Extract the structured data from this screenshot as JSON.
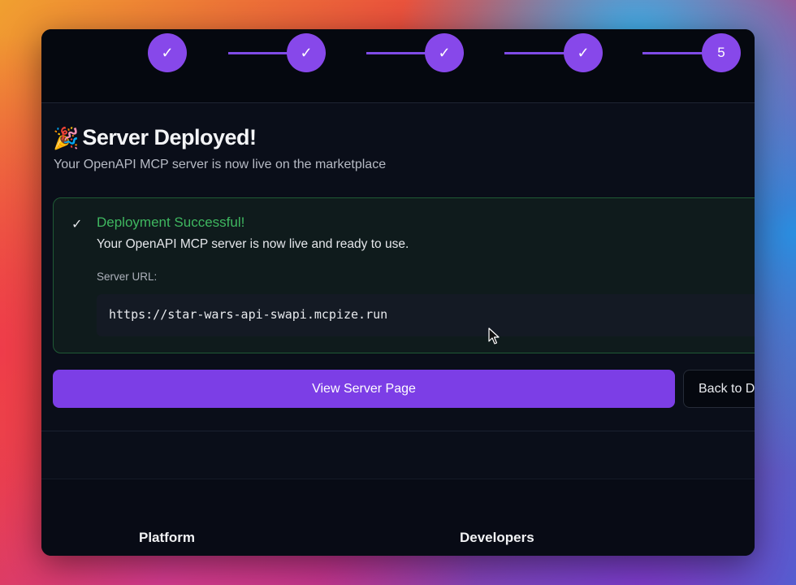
{
  "stepper": {
    "steps": [
      {
        "label": "✓",
        "state": "completed"
      },
      {
        "label": "✓",
        "state": "completed"
      },
      {
        "label": "✓",
        "state": "completed"
      },
      {
        "label": "✓",
        "state": "completed"
      },
      {
        "label": "5",
        "state": "current"
      }
    ]
  },
  "header": {
    "emoji": "🎉",
    "title": "Server Deployed!",
    "subtitle": "Your OpenAPI MCP server is now live on the marketplace"
  },
  "success": {
    "icon": "check-icon",
    "title": "Deployment Successful!",
    "message": "Your OpenAPI MCP server is now live and ready to use.",
    "url_label": "Server URL:",
    "url": "https://star-wars-api-swapi.mcpize.run"
  },
  "actions": {
    "primary_label": "View Server Page",
    "secondary_label": "Back to D"
  },
  "footer": {
    "columns": [
      "Platform",
      "Developers"
    ]
  },
  "colors": {
    "accent": "#7c3ee6",
    "success": "#3fb760",
    "background": "#0a0e19"
  }
}
